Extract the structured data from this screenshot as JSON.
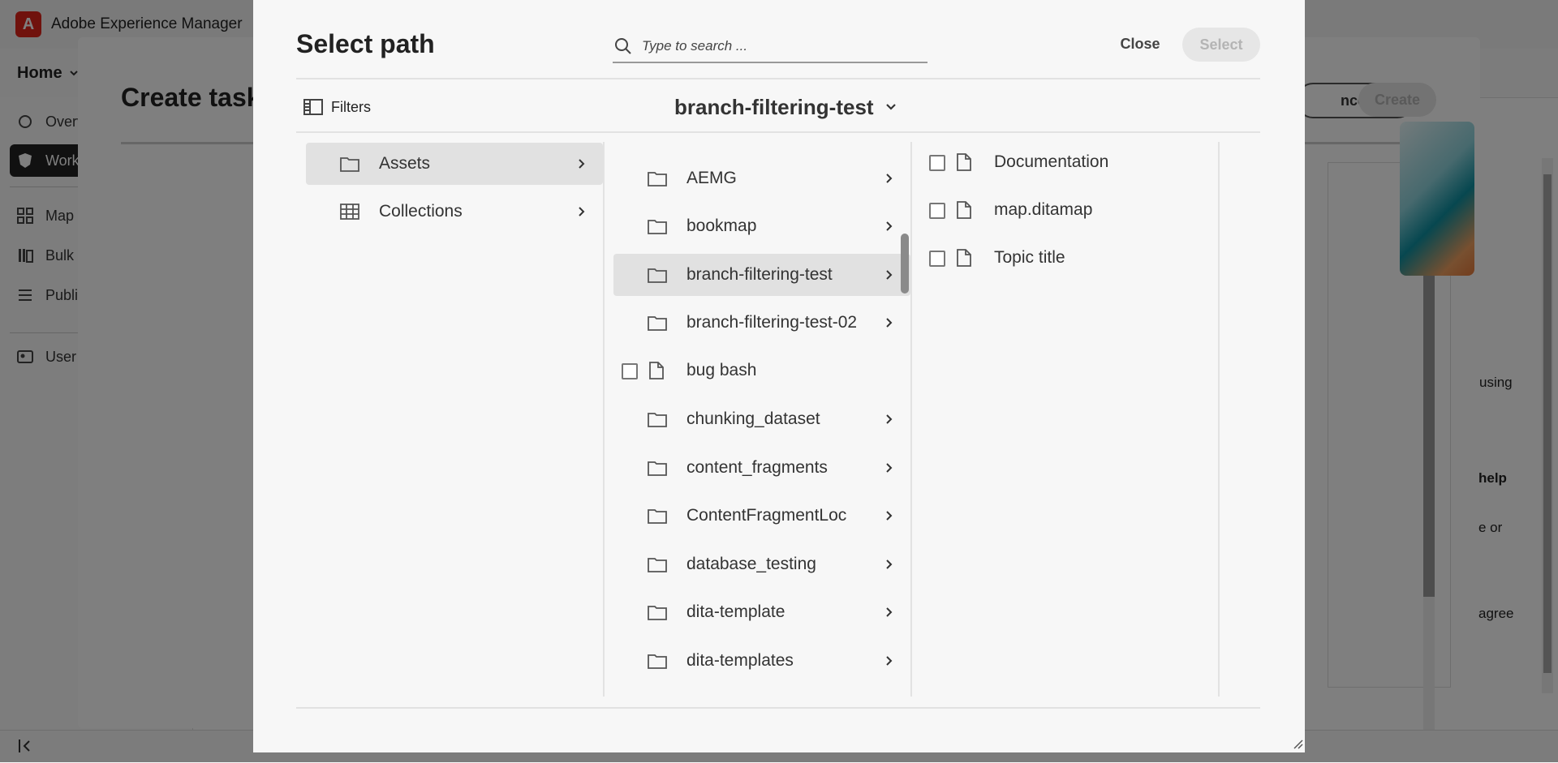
{
  "app": {
    "title": "Adobe Experience Manager",
    "logo_letter": "A"
  },
  "header": {
    "home_label": "Home"
  },
  "sidebar": {
    "items": [
      {
        "label": "Overv",
        "icon": "overview-icon"
      },
      {
        "label": "Work",
        "icon": "workspace-icon",
        "active": true
      },
      {
        "label": "Map",
        "icon": "map-icon"
      },
      {
        "label": "Bulk",
        "icon": "bulk-icon"
      },
      {
        "label": "Publi",
        "icon": "publish-icon"
      },
      {
        "label": "User",
        "icon": "user-icon"
      }
    ]
  },
  "create_task": {
    "title": "Create task",
    "cancel_label": "ncel",
    "create_label": "Create",
    "side_texts": [
      "using",
      "help",
      "e or",
      "agree"
    ]
  },
  "dialog": {
    "title": "Select path",
    "search_placeholder": "Type to search ...",
    "close_label": "Close",
    "select_label": "Select",
    "filters_label": "Filters",
    "current_path": "branch-filtering-test",
    "columns": [
      {
        "items": [
          {
            "label": "Assets",
            "type": "folder",
            "selected": true,
            "has_children": true
          },
          {
            "label": "Collections",
            "type": "collection",
            "selected": false,
            "has_children": true
          }
        ]
      },
      {
        "items": [
          {
            "label": "AEMG",
            "type": "folder",
            "has_children": true
          },
          {
            "label": "bookmap",
            "type": "folder",
            "has_children": true
          },
          {
            "label": "branch-filtering-test",
            "type": "folder",
            "selected": true,
            "has_children": true
          },
          {
            "label": "branch-filtering-test-02",
            "type": "folder",
            "has_children": true
          },
          {
            "label": "bug bash",
            "type": "file",
            "checkbox": true
          },
          {
            "label": "chunking_dataset",
            "type": "folder",
            "has_children": true
          },
          {
            "label": "content_fragments",
            "type": "folder",
            "has_children": true
          },
          {
            "label": "ContentFragmentLoc",
            "type": "folder",
            "has_children": true
          },
          {
            "label": "database_testing",
            "type": "folder",
            "has_children": true
          },
          {
            "label": "dita-template",
            "type": "folder",
            "has_children": true
          },
          {
            "label": "dita-templates",
            "type": "folder",
            "has_children": true
          }
        ]
      },
      {
        "items": [
          {
            "label": "Documentation",
            "type": "file",
            "checkbox": true
          },
          {
            "label": "map.ditamap",
            "type": "file",
            "checkbox": true
          },
          {
            "label": "Topic title",
            "type": "file",
            "checkbox": true
          }
        ]
      }
    ]
  },
  "colors": {
    "accent": "#e1251b",
    "selected_row": "#e1e1e1",
    "dialog_bg": "#f7f7f7"
  }
}
